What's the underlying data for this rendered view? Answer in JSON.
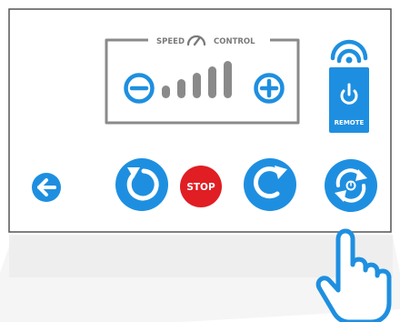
{
  "speed_control": {
    "label_left": "SPEED",
    "label_right": "CONTROL",
    "bars": 5,
    "minus_icon": "minus-circle-icon",
    "plus_icon": "plus-circle-icon",
    "gauge_icon": "speedometer-icon"
  },
  "remote": {
    "label": "REMOTE",
    "icon": "wireless-signal-icon",
    "power_icon": "power-icon"
  },
  "controls": {
    "back_icon": "arrow-left-icon",
    "rotate_left_icon": "rotate-counterclockwise-icon",
    "stop_label": "STOP",
    "rotate_right_icon": "rotate-clockwise-icon",
    "auto_rotate_icon": "auto-rotate-timer-icon"
  },
  "overlay": {
    "pointer_icon": "hand-pointer-icon"
  },
  "colors": {
    "accent_blue": "#1e8fe0",
    "stop_red": "#e01e24",
    "frame_gray": "#555555",
    "speed_gray": "#8a8a8a",
    "shadow": "#e7e7e7"
  }
}
